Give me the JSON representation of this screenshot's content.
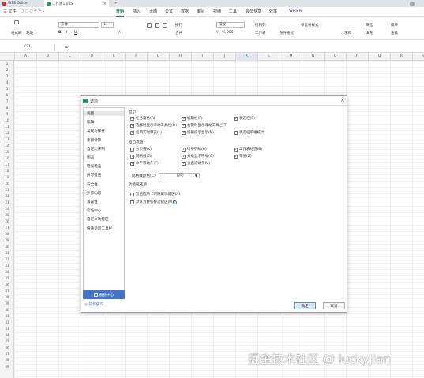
{
  "titlebar": {
    "tabs": [
      {
        "label": "WPS Office",
        "color": "#d0312d"
      },
      {
        "label": "工作簿1.xlsx",
        "color": "#1f9d55"
      }
    ],
    "add_tab": "+"
  },
  "menubar": {
    "file": "三 文件",
    "items": [
      "开始",
      "插入",
      "页面",
      "公式",
      "数据",
      "审阅",
      "视图",
      "工具",
      "会员专享",
      "效率"
    ],
    "active": "开始",
    "ai": "WPS AI"
  },
  "ribbon": {
    "format_painter": "格式刷",
    "paste": "粘贴",
    "font_name": "宋体",
    "font_size": "11",
    "wrap": "换行",
    "merge": "合并",
    "number_format": "常规",
    "conditional": "行和列",
    "sheet": "工作表",
    "cell_format": "条件格式",
    "cell_style": "单元格样式",
    "sum": "求和",
    "filter": "筛选",
    "sort": "排序",
    "fill": "填充",
    "find": "查找",
    "freeze": "冻结"
  },
  "formula_bar": {
    "name_box": "K21",
    "fx": "fx"
  },
  "sheet": {
    "columns": [
      "A",
      "B",
      "C",
      "D",
      "E",
      "F",
      "G",
      "H",
      "I",
      "J",
      "K",
      "L",
      "M",
      "N",
      "O",
      "P",
      "Q",
      "R",
      "S"
    ],
    "selected_column": "K",
    "rows": [
      "1",
      "2",
      "3",
      "4",
      "5",
      "6",
      "7",
      "8",
      "9",
      "10",
      "11",
      "12",
      "13",
      "14",
      "15",
      "16",
      "17",
      "18",
      "19",
      "20",
      "21",
      "22",
      "23",
      "24",
      "25",
      "26",
      "27",
      "28",
      "29",
      "30",
      "31",
      "32",
      "33",
      "34",
      "35",
      "36",
      "37",
      "38",
      "39",
      "40",
      "41",
      "42",
      "43",
      "44",
      "45",
      "46",
      "47",
      "48",
      "49"
    ]
  },
  "dialog": {
    "title": "选项",
    "close": "×",
    "sidebar": [
      "视图",
      "编辑",
      "常规与保存",
      "重新计算",
      "自定义序列",
      "图表",
      "错误检查",
      "拼写检查",
      "安全性",
      "外部内容",
      "兼容性",
      "信任中心",
      "自定义功能区",
      "快速访问工具栏"
    ],
    "selected": "视图",
    "backup_label": "备份中心",
    "tips_label": "操作技巧",
    "sections": {
      "display": {
        "title": "显示",
        "options": [
          {
            "label": "任务窗格(R)",
            "checked": false
          },
          {
            "label": "编辑栏(F)",
            "checked": true
          },
          {
            "label": "状态栏(S)",
            "checked": true
          },
          {
            "label": "选择时显示浮动工具栏(D)",
            "checked": true
          },
          {
            "label": "右键时显示浮动工具栏(T)",
            "checked": true
          },
          {
            "label": "启用实时预览(L)",
            "checked": true
          },
          {
            "label": "屏幕提示显示(N)",
            "checked": true
          },
          {
            "label": "状态栏单格统计",
            "checked": false
          }
        ]
      },
      "window": {
        "title": "窗口选项",
        "options": [
          {
            "label": "分页符(K)",
            "checked": false
          },
          {
            "label": "行号列标(H)",
            "checked": true
          },
          {
            "label": "工作表标签(B)",
            "checked": true
          },
          {
            "label": "网格线(G)",
            "checked": true
          },
          {
            "label": "分级显示符号(O)",
            "checked": true
          },
          {
            "label": "零值(Z)",
            "checked": true
          },
          {
            "label": "水平滚动条(T)",
            "checked": true
          },
          {
            "label": "垂直滚动条(V)",
            "checked": true
          }
        ],
        "grid_color_label": "网格线颜色(C):",
        "grid_color_value": "自动"
      },
      "ribbon": {
        "title": "功能区选项",
        "options": [
          {
            "label": "双击选项卡时隐藏功能区(A)",
            "checked": false
          },
          {
            "label": "默认为并折叠功能区(M)",
            "checked": false
          }
        ]
      }
    },
    "ok": "确定",
    "cancel": "取消"
  },
  "watermark": "掘金技术社区 @ luckyJian"
}
